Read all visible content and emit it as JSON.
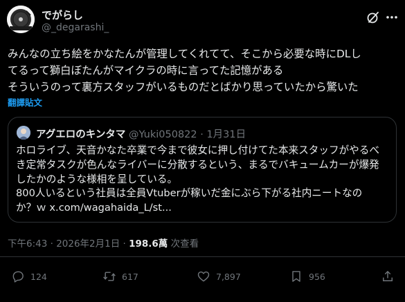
{
  "post": {
    "author_name": "でがらし",
    "author_handle": "@_degarashi_",
    "text_lines": [
      "みんなの立ち絵をかなたんが管理してくれてて、そこから必要な時にDLし",
      "てるって獅白ぼたんがマイクラの時に言ってた記憶がある",
      "そういうのって裏方スタッフがいるものだとばかり思っていたから驚いた"
    ],
    "translate_label": "翻譯貼文",
    "timestamp": "下午6:43 · 2026年2月1日 · ",
    "views_count": "198.6萬",
    "views_label": " 次查看"
  },
  "quote": {
    "author_name": "アグエロのキンタマ",
    "author_handle": "@Yuki050822",
    "date": " · 1月31日",
    "text_lines": [
      "ホロライブ、天音かなた卒業で今まで彼女に押し付けてた本来スタッフがやるべ",
      "き定常タスクが色んなライバーに分散するという、まるでバキュームカーが爆発",
      "したかのような様相を呈している。",
      "800人いるという社員は全員Vtuberが稼いだ金にぶら下がる社内ニートなの",
      "か？ｗ x.com/wagahaida_L/st..."
    ]
  },
  "actions": {
    "replies": "124",
    "reposts": "617",
    "likes": "7,897",
    "bookmarks": "956"
  },
  "icons": [
    "reply-icon",
    "repost-icon",
    "like-icon",
    "bookmark-icon",
    "share-icon",
    "grok-icon",
    "more-icon"
  ],
  "colors": {
    "background": "#000000",
    "text": "#e7e9ea",
    "secondary": "#71767b",
    "link": "#1d9bf0",
    "border": "#2f3336"
  }
}
